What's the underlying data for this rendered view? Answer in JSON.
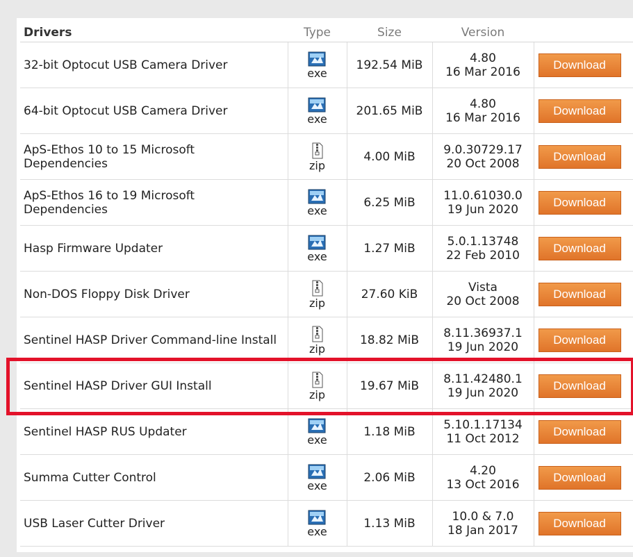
{
  "table": {
    "headers": {
      "name": "Drivers",
      "type": "Type",
      "size": "Size",
      "version": "Version"
    },
    "download_label": "Download",
    "rows": [
      {
        "name": "32-bit Optocut USB Camera Driver",
        "type": "exe",
        "size": "192.54 MiB",
        "version": "4.80",
        "date": "16 Mar 2016",
        "icon": "exe-icon"
      },
      {
        "name": "64-bit Optocut USB Camera Driver",
        "type": "exe",
        "size": "201.65 MiB",
        "version": "4.80",
        "date": "16 Mar 2016",
        "icon": "exe-icon"
      },
      {
        "name": "ApS-Ethos 10 to 15 Microsoft Dependencies",
        "type": "zip",
        "size": "4.00 MiB",
        "version": "9.0.30729.17",
        "date": "20 Oct 2008",
        "icon": "zip-icon"
      },
      {
        "name": "ApS-Ethos 16 to 19 Microsoft Dependencies",
        "type": "exe",
        "size": "6.25 MiB",
        "version": "11.0.61030.0",
        "date": "19 Jun 2020",
        "icon": "exe-icon"
      },
      {
        "name": "Hasp Firmware Updater",
        "type": "exe",
        "size": "1.27 MiB",
        "version": "5.0.1.13748",
        "date": "22 Feb 2010",
        "icon": "exe-icon"
      },
      {
        "name": "Non-DOS Floppy Disk Driver",
        "type": "zip",
        "size": "27.60 KiB",
        "version": "Vista",
        "date": "20 Oct 2008",
        "icon": "zip-icon"
      },
      {
        "name": "Sentinel HASP Driver Command-line Install",
        "type": "zip",
        "size": "18.82 MiB",
        "version": "8.11.36937.1",
        "date": "19 Jun 2020",
        "icon": "zip-icon"
      },
      {
        "name": "Sentinel HASP Driver GUI Install",
        "type": "zip",
        "size": "19.67 MiB",
        "version": "8.11.42480.1",
        "date": "19 Jun 2020",
        "icon": "zip-icon"
      },
      {
        "name": "Sentinel HASP RUS Updater",
        "type": "exe",
        "size": "1.18 MiB",
        "version": "5.10.1.17134",
        "date": "11 Oct 2012",
        "icon": "exe-icon"
      },
      {
        "name": "Summa Cutter Control",
        "type": "exe",
        "size": "2.06 MiB",
        "version": "4.20",
        "date": "13 Oct 2016",
        "icon": "exe-icon"
      },
      {
        "name": "USB Laser Cutter Driver",
        "type": "exe",
        "size": "1.13 MiB",
        "version": "10.0 & 7.0",
        "date": "18 Jan 2017",
        "icon": "exe-icon"
      }
    ]
  },
  "colors": {
    "download_button": "#e0742a",
    "highlight": "#e3122a"
  }
}
